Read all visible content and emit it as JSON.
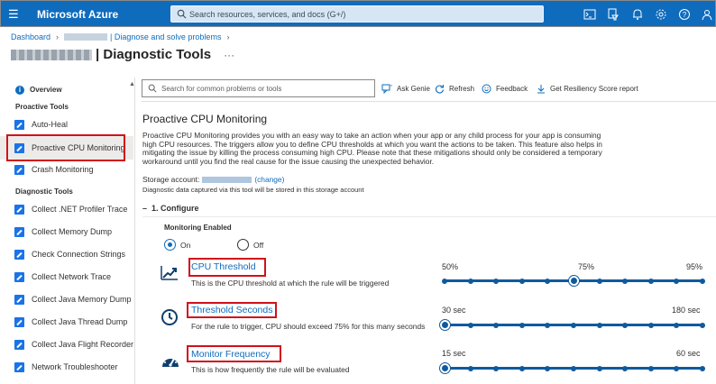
{
  "topbar": {
    "brand": "Microsoft Azure",
    "search_placeholder": "Search resources, services, and docs (G+/)",
    "icons": [
      "cloud-shell-icon",
      "directory-filter-icon",
      "notifications-icon",
      "settings-icon",
      "help-icon",
      "feedback-icon"
    ]
  },
  "breadcrumb": {
    "dashboard": "Dashboard",
    "page": "| Diagnose and solve problems"
  },
  "title": "| Diagnostic Tools",
  "more": "···",
  "sidebar": {
    "overview": "Overview",
    "proactive_header": "Proactive Tools",
    "proactive_items": [
      "Auto-Heal",
      "Proactive CPU Monitoring",
      "Crash Monitoring"
    ],
    "diagnostic_header": "Diagnostic Tools",
    "diagnostic_items": [
      "Collect .NET Profiler Trace",
      "Collect Memory Dump",
      "Check Connection Strings",
      "Collect Network Trace",
      "Collect Java Memory Dump",
      "Collect Java Thread Dump",
      "Collect Java Flight Recorder",
      "Network Troubleshooter"
    ]
  },
  "toolbar": {
    "search_placeholder": "Search for common problems or tools",
    "ask_genie": "Ask Genie",
    "refresh": "Refresh",
    "feedback": "Feedback",
    "resiliency": "Get Resiliency Score report"
  },
  "content": {
    "heading": "Proactive CPU Monitoring",
    "description": "Proactive CPU Monitoring provides you with an easy way to take an action when your app or any child process for your app is consuming high CPU resources. The triggers allow you to define CPU thresholds at which you want the actions to be taken. This feature also helps in mitigating the issue by killing the process consuming high CPU. Please note that these mitigations should only be considered a temporary workaround until you find the real cause for the issue causing the unexpected behavior.",
    "storage_label": "Storage account:",
    "storage_change": "(change)",
    "storage_note": "Diagnostic data captured via this tool will be stored in this storage account",
    "section": "1. Configure",
    "monitoring_enabled": "Monitoring Enabled",
    "radio_on": "On",
    "radio_off": "Off",
    "monitoring_on": true
  },
  "settings": {
    "cpu": {
      "title": "CPU Threshold",
      "subtitle": "This is the CPU threshold at which the rule will be triggered",
      "labels": [
        "50%",
        "75%",
        "95%"
      ],
      "steps": 10,
      "value_index": 5
    },
    "seconds": {
      "title": "Threshold Seconds",
      "subtitle": "For the rule to trigger, CPU should exceed 75% for this many seconds",
      "labels": [
        "30 sec",
        "180 sec"
      ],
      "steps": 10,
      "value_index": 0
    },
    "frequency": {
      "title": "Monitor Frequency",
      "subtitle": "This is how frequently the rule will be evaluated",
      "labels": [
        "15 sec",
        "60 sec"
      ],
      "steps": 10,
      "value_index": 0
    }
  },
  "colors": {
    "accent": "#0f6cbd",
    "highlight": "#d0111b"
  }
}
